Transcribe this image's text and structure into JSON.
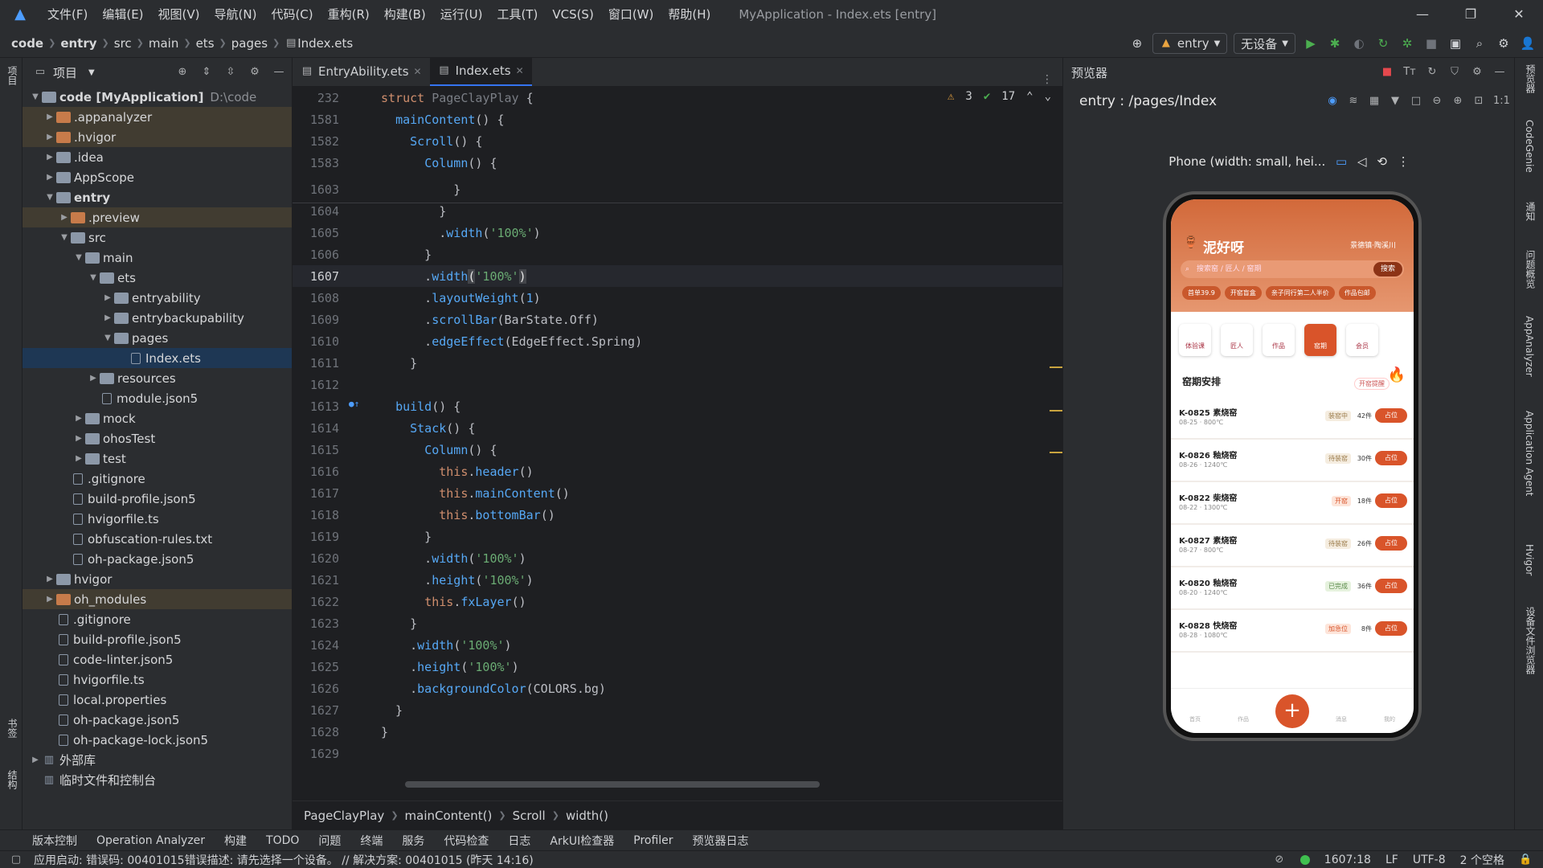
{
  "titlebar": {
    "menus": [
      "文件(F)",
      "编辑(E)",
      "视图(V)",
      "导航(N)",
      "代码(C)",
      "重构(R)",
      "构建(B)",
      "运行(U)",
      "工具(T)",
      "VCS(S)",
      "窗口(W)",
      "帮助(H)"
    ],
    "window_title": "MyApplication - Index.ets [entry]"
  },
  "navbar": {
    "crumbs": [
      "code",
      "entry",
      "src",
      "main",
      "ets",
      "pages",
      "Index.ets"
    ],
    "module": "entry",
    "device": "无设备"
  },
  "left_strip": {
    "project": "项目",
    "bookmarks": "书签",
    "structure": "结构"
  },
  "project": {
    "title": "项目",
    "rows": [
      {
        "label": "code [MyApplication]",
        "path": "D:\\code",
        "indent": 0,
        "arrow": "▼",
        "icon": "folder",
        "bold": true
      },
      {
        "label": ".appanalyzer",
        "indent": 1,
        "arrow": "▶",
        "icon": "orange",
        "hl": true
      },
      {
        "label": ".hvigor",
        "indent": 1,
        "arrow": "▶",
        "icon": "orange",
        "hl": true
      },
      {
        "label": ".idea",
        "indent": 1,
        "arrow": "▶",
        "icon": "folder"
      },
      {
        "label": "AppScope",
        "indent": 1,
        "arrow": "▶",
        "icon": "folder"
      },
      {
        "label": "entry",
        "indent": 1,
        "arrow": "▼",
        "icon": "folder",
        "bold": true
      },
      {
        "label": ".preview",
        "indent": 2,
        "arrow": "▶",
        "icon": "orange",
        "hl": true
      },
      {
        "label": "src",
        "indent": 2,
        "arrow": "▼",
        "icon": "folder"
      },
      {
        "label": "main",
        "indent": 3,
        "arrow": "▼",
        "icon": "folder"
      },
      {
        "label": "ets",
        "indent": 4,
        "arrow": "▼",
        "icon": "folder"
      },
      {
        "label": "entryability",
        "indent": 5,
        "arrow": "▶",
        "icon": "folder"
      },
      {
        "label": "entrybackupability",
        "indent": 5,
        "arrow": "▶",
        "icon": "folder"
      },
      {
        "label": "pages",
        "indent": 5,
        "arrow": "▼",
        "icon": "folder"
      },
      {
        "label": "Index.ets",
        "indent": 6,
        "arrow": "",
        "icon": "file",
        "sel": true
      },
      {
        "label": "resources",
        "indent": 4,
        "arrow": "▶",
        "icon": "folder"
      },
      {
        "label": "module.json5",
        "indent": 4,
        "arrow": "",
        "icon": "file"
      },
      {
        "label": "mock",
        "indent": 3,
        "arrow": "▶",
        "icon": "folder"
      },
      {
        "label": "ohosTest",
        "indent": 3,
        "arrow": "▶",
        "icon": "folder"
      },
      {
        "label": "test",
        "indent": 3,
        "arrow": "▶",
        "icon": "folder"
      },
      {
        "label": ".gitignore",
        "indent": 2,
        "arrow": "",
        "icon": "file"
      },
      {
        "label": "build-profile.json5",
        "indent": 2,
        "arrow": "",
        "icon": "file"
      },
      {
        "label": "hvigorfile.ts",
        "indent": 2,
        "arrow": "",
        "icon": "file"
      },
      {
        "label": "obfuscation-rules.txt",
        "indent": 2,
        "arrow": "",
        "icon": "file"
      },
      {
        "label": "oh-package.json5",
        "indent": 2,
        "arrow": "",
        "icon": "file"
      },
      {
        "label": "hvigor",
        "indent": 1,
        "arrow": "▶",
        "icon": "folder"
      },
      {
        "label": "oh_modules",
        "indent": 1,
        "arrow": "▶",
        "icon": "orange",
        "hl": true
      },
      {
        "label": ".gitignore",
        "indent": 1,
        "arrow": "",
        "icon": "file"
      },
      {
        "label": "build-profile.json5",
        "indent": 1,
        "arrow": "",
        "icon": "file"
      },
      {
        "label": "code-linter.json5",
        "indent": 1,
        "arrow": "",
        "icon": "file"
      },
      {
        "label": "hvigorfile.ts",
        "indent": 1,
        "arrow": "",
        "icon": "file"
      },
      {
        "label": "local.properties",
        "indent": 1,
        "arrow": "",
        "icon": "file"
      },
      {
        "label": "oh-package.json5",
        "indent": 1,
        "arrow": "",
        "icon": "file"
      },
      {
        "label": "oh-package-lock.json5",
        "indent": 1,
        "arrow": "",
        "icon": "file"
      },
      {
        "label": "外部库",
        "indent": 0,
        "arrow": "▶",
        "icon": "lib"
      },
      {
        "label": "临时文件和控制台",
        "indent": 0,
        "arrow": "",
        "icon": "lib"
      }
    ]
  },
  "editor": {
    "tabs": [
      {
        "label": "EntryAbility.ets",
        "active": false
      },
      {
        "label": "Index.ets",
        "active": true
      }
    ],
    "warnings": "3",
    "checks": "17",
    "lines": [
      {
        "n": "232",
        "sticky": true,
        "html": "<span class='kw'>struct</span> <span class='gry'>PageClayPlay</span> {"
      },
      {
        "n": "1581",
        "sticky": true,
        "html": "  <span class='fn'>mainContent</span>() {"
      },
      {
        "n": "1582",
        "sticky": true,
        "html": "    <span class='fn'>Scroll</span>() {"
      },
      {
        "n": "1583",
        "sticky": true,
        "html": "      <span class='fn'>Column</span>() {"
      },
      {
        "n": "1603",
        "html": "          }"
      },
      {
        "n": "1604",
        "html": "        }"
      },
      {
        "n": "1605",
        "html": "        .<span class='fn'>width</span>(<span class='st'>'100%'</span>)"
      },
      {
        "n": "1606",
        "html": "      }"
      },
      {
        "n": "1607",
        "cur": true,
        "html": "      .<span class='fn'>width</span><span class='brk'>(</span><span class='st'>'100%'</span><span class='brk'>)</span>"
      },
      {
        "n": "1608",
        "html": "      .<span class='fn'>layoutWeight</span>(<span class='fn'>1</span>)"
      },
      {
        "n": "1609",
        "html": "      .<span class='fn'>scrollBar</span>(BarState.Off)"
      },
      {
        "n": "1610",
        "html": "      .<span class='fn'>edgeEffect</span>(EdgeEffect.Spring)"
      },
      {
        "n": "1611",
        "html": "    }"
      },
      {
        "n": "1612",
        "html": ""
      },
      {
        "n": "1613",
        "html": "  <span class='fn'>build</span>() {"
      },
      {
        "n": "1614",
        "html": "    <span class='fn'>Stack</span>() {"
      },
      {
        "n": "1615",
        "html": "      <span class='fn'>Column</span>() {"
      },
      {
        "n": "1616",
        "html": "        <span class='kw'>this</span>.<span class='fn'>header</span>()"
      },
      {
        "n": "1617",
        "html": "        <span class='kw'>this</span>.<span class='fn'>mainContent</span>()"
      },
      {
        "n": "1618",
        "html": "        <span class='kw'>this</span>.<span class='fn'>bottomBar</span>()"
      },
      {
        "n": "1619",
        "html": "      }"
      },
      {
        "n": "1620",
        "html": "      .<span class='fn'>width</span>(<span class='st'>'100%'</span>)"
      },
      {
        "n": "1621",
        "html": "      .<span class='fn'>height</span>(<span class='st'>'100%'</span>)"
      },
      {
        "n": "1622",
        "html": "      <span class='kw'>this</span>.<span class='fn'>fxLayer</span>()"
      },
      {
        "n": "1623",
        "html": "    }"
      },
      {
        "n": "1624",
        "html": "    .<span class='fn'>width</span>(<span class='st'>'100%'</span>)"
      },
      {
        "n": "1625",
        "html": "    .<span class='fn'>height</span>(<span class='st'>'100%'</span>)"
      },
      {
        "n": "1626",
        "html": "    .<span class='fn'>backgroundColor</span>(COLORS.bg)"
      },
      {
        "n": "1627",
        "html": "  }"
      },
      {
        "n": "1628",
        "html": "}"
      },
      {
        "n": "1629",
        "html": ""
      }
    ],
    "breadcrumbs": [
      "PageClayPlay",
      "mainContent()",
      "Scroll",
      "width()"
    ]
  },
  "preview": {
    "title": "预览器",
    "path": "entry : /pages/Index",
    "device": "Phone (width: small, hei...",
    "app": {
      "brand": "泥好呀",
      "location": "景德镇·陶溪川",
      "search_placeholder": "搜索窑 / 匠人 / 窑期",
      "search_button": "搜索",
      "chips": [
        "首单39.9",
        "开窑盲盒",
        "亲子同行第二人半价",
        "作品包邮"
      ],
      "categories": [
        {
          "label": "体验课",
          "on": false
        },
        {
          "label": "匠人",
          "on": false
        },
        {
          "label": "作品",
          "on": false
        },
        {
          "label": "窑期",
          "on": true
        },
        {
          "label": "会员",
          "on": false
        }
      ],
      "section_title": "窑期安排",
      "section_link": "开窑提醒",
      "items": [
        {
          "title": "K-0825 素烧窑",
          "sub": "08-25 · 800℃",
          "tag": "装窑中",
          "tag_color": "#9b7b4a",
          "tag_bg": "#f5ede0",
          "count": "42件",
          "button": "占位"
        },
        {
          "title": "K-0826 釉烧窑",
          "sub": "08-26 · 1240℃",
          "tag": "待装窑",
          "tag_color": "#9b7b4a",
          "tag_bg": "#f5ede0",
          "count": "30件",
          "button": "占位"
        },
        {
          "title": "K-0822 柴烧窑",
          "sub": "08-22 · 1300℃",
          "tag": "开窑",
          "tag_color": "#d9542a",
          "tag_bg": "#fde5da",
          "count": "18件",
          "button": "占位"
        },
        {
          "title": "K-0827 素烧窑",
          "sub": "08-27 · 800℃",
          "tag": "待装窑",
          "tag_color": "#9b7b4a",
          "tag_bg": "#f5ede0",
          "count": "26件",
          "button": "占位"
        },
        {
          "title": "K-0820 釉烧窑",
          "sub": "08-20 · 1240℃",
          "tag": "已完成",
          "tag_color": "#5a8a4a",
          "tag_bg": "#e6f2de",
          "count": "36件",
          "button": "占位"
        },
        {
          "title": "K-0828 快烧窑",
          "sub": "08-28 · 1080℃",
          "tag": "加急位",
          "tag_color": "#d9542a",
          "tag_bg": "#fde5da",
          "count": "8件",
          "button": "占位"
        }
      ],
      "tabs": [
        "首页",
        "作品",
        "",
        "消息",
        "我的"
      ]
    }
  },
  "right_strip": [
    "预览器",
    "CodeGenie",
    "通知",
    "问题概览",
    "AppAnalyzer",
    "Application Agent",
    "Hvigor",
    "设备文件浏览器"
  ],
  "toolwindows": [
    "版本控制",
    "Operation Analyzer",
    "构建",
    "TODO",
    "问题",
    "终端",
    "服务",
    "代码检查",
    "日志",
    "ArkUI检查器",
    "Profiler",
    "预览器日志"
  ],
  "status": {
    "message": "应用启动: 错误码: 00401015错误描述: 请先选择一个设备。 // 解决方案: 00401015 (昨天 14:16)",
    "position": "1607:18",
    "line_sep": "LF",
    "encoding": "UTF-8",
    "indent": "2 个空格"
  }
}
